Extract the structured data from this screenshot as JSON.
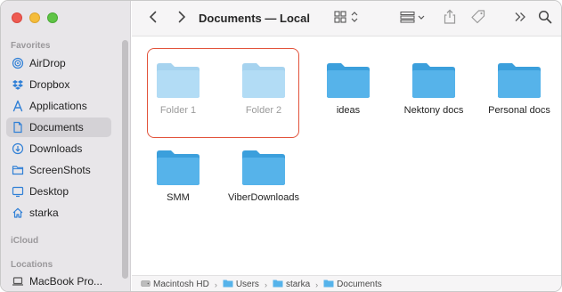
{
  "window": {
    "title": "Documents — Local"
  },
  "sidebar": {
    "sections": [
      {
        "title": "Favorites"
      },
      {
        "title": "iCloud"
      },
      {
        "title": "Locations"
      }
    ],
    "favorites": [
      {
        "label": "AirDrop",
        "icon": "airdrop-icon"
      },
      {
        "label": "Dropbox",
        "icon": "dropbox-icon"
      },
      {
        "label": "Applications",
        "icon": "applications-icon"
      },
      {
        "label": "Documents",
        "icon": "document-icon",
        "selected": true
      },
      {
        "label": "Downloads",
        "icon": "download-icon"
      },
      {
        "label": "ScreenShots",
        "icon": "folder-icon"
      },
      {
        "label": "Desktop",
        "icon": "desktop-icon"
      },
      {
        "label": "starka",
        "icon": "home-icon"
      }
    ],
    "locations": [
      {
        "label": "MacBook Pro...",
        "icon": "laptop-icon"
      }
    ]
  },
  "toolbar": {
    "back": "chevron-left-icon",
    "forward": "chevron-right-icon",
    "view": "icon-grid-view-icon",
    "group": "group-by-icon",
    "share": "share-icon",
    "tag": "tag-icon",
    "more": "more-chevrons-icon",
    "search": "search-icon"
  },
  "content": {
    "items": [
      {
        "name": "Folder 1",
        "faded": true
      },
      {
        "name": "Folder 2",
        "faded": true
      },
      {
        "name": "ideas",
        "faded": false
      },
      {
        "name": "Nektony docs",
        "faded": false
      },
      {
        "name": "Personal docs",
        "faded": false
      },
      {
        "name": "SMM",
        "faded": false
      },
      {
        "name": "ViberDownloads",
        "faded": false
      }
    ]
  },
  "pathbar": {
    "crumbs": [
      {
        "label": "Macintosh HD",
        "icon": "hard-drive-icon"
      },
      {
        "label": "Users",
        "icon": "folder-icon"
      },
      {
        "label": "starka",
        "icon": "folder-icon"
      },
      {
        "label": "Documents",
        "icon": "folder-icon"
      }
    ]
  },
  "colors": {
    "folder_front": "#56b3ea",
    "folder_back": "#3b9fdc",
    "selection_outline": "#e2533b",
    "sidebar_bg": "#e8e6e9"
  }
}
